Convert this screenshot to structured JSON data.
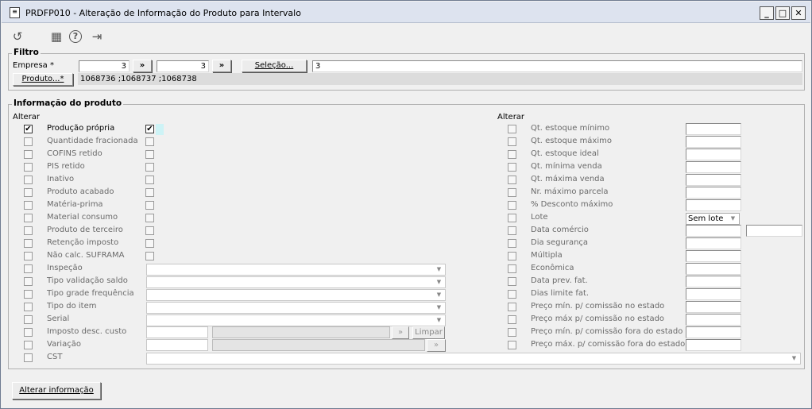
{
  "window": {
    "title": "PRDFP010 - Alteração de Informação do Produto para Intervalo",
    "minimize": "_",
    "maximize": "□",
    "close": "✕"
  },
  "toolbar": {
    "icons": [
      "undo-icon",
      "calendar-icon",
      "help-icon",
      "exit-icon"
    ],
    "glyphs": {
      "undo": "↺",
      "calendar": "▦",
      "help": "?",
      "exit": "⇥"
    }
  },
  "filtro": {
    "legend": "Filtro",
    "empresa_label": "Empresa *",
    "empresa_from": "3",
    "empresa_to": "3",
    "next_label": "»",
    "selecao_label": "Seleção...",
    "selecao_value": "3",
    "produto_label": "Produto...*",
    "produto_value": "1068736 ;1068737 ;1068738"
  },
  "info": {
    "legend": "Informação do produto",
    "alterar_left": "Alterar",
    "alterar_right": "Alterar",
    "left_rows": [
      {
        "label": "Produção própria",
        "alter": true,
        "value": true
      },
      {
        "label": "Quantidade fracionada",
        "alter": false,
        "value": false
      },
      {
        "label": "COFINS retido",
        "alter": false,
        "value": false
      },
      {
        "label": "PIS retido",
        "alter": false,
        "value": false
      },
      {
        "label": "Inativo",
        "alter": false,
        "value": false
      },
      {
        "label": "Produto acabado",
        "alter": false,
        "value": false
      },
      {
        "label": "Matéria-prima",
        "alter": false,
        "value": false
      },
      {
        "label": "Material consumo",
        "alter": false,
        "value": false
      },
      {
        "label": "Produto de terceiro",
        "alter": false,
        "value": false
      },
      {
        "label": "Retenção imposto",
        "alter": false,
        "value": false
      },
      {
        "label": "Não calc. SUFRAMA",
        "alter": false,
        "value": false
      }
    ],
    "left_select_rows": [
      "Inspeção",
      "Tipo validação saldo",
      "Tipo grade frequência",
      "Tipo do item",
      "Serial"
    ],
    "imposto_label": "Imposto desc. custo",
    "variacao_label": "Variação",
    "cst_label": "CST",
    "limpar_label": "Limpar",
    "expand_glyph": "»",
    "right_rows": [
      "Qt. estoque mínimo",
      "Qt. estoque máximo",
      "Qt. estoque ideal",
      "Qt. mínima venda",
      "Qt. máxima venda",
      "Nr. máximo parcela",
      "% Desconto máximo",
      "Lote",
      "Data comércio",
      "Dia segurança",
      "Múltipla",
      "Econômica",
      "Data prev. fat.",
      "Dias limite fat.",
      "Preço mín. p/ comissão no estado",
      "Preço máx p/ comissão no estado",
      "Preço mín. p/ comissão fora do estado",
      "Preço máx. p/ comissão fora do estado"
    ],
    "lote_value": "Sem lote"
  },
  "footer": {
    "alterar_button": "Alterar informação"
  },
  "colors": {
    "titlebar": "#dde3ef",
    "disabled_text": "#6a6a6a"
  }
}
